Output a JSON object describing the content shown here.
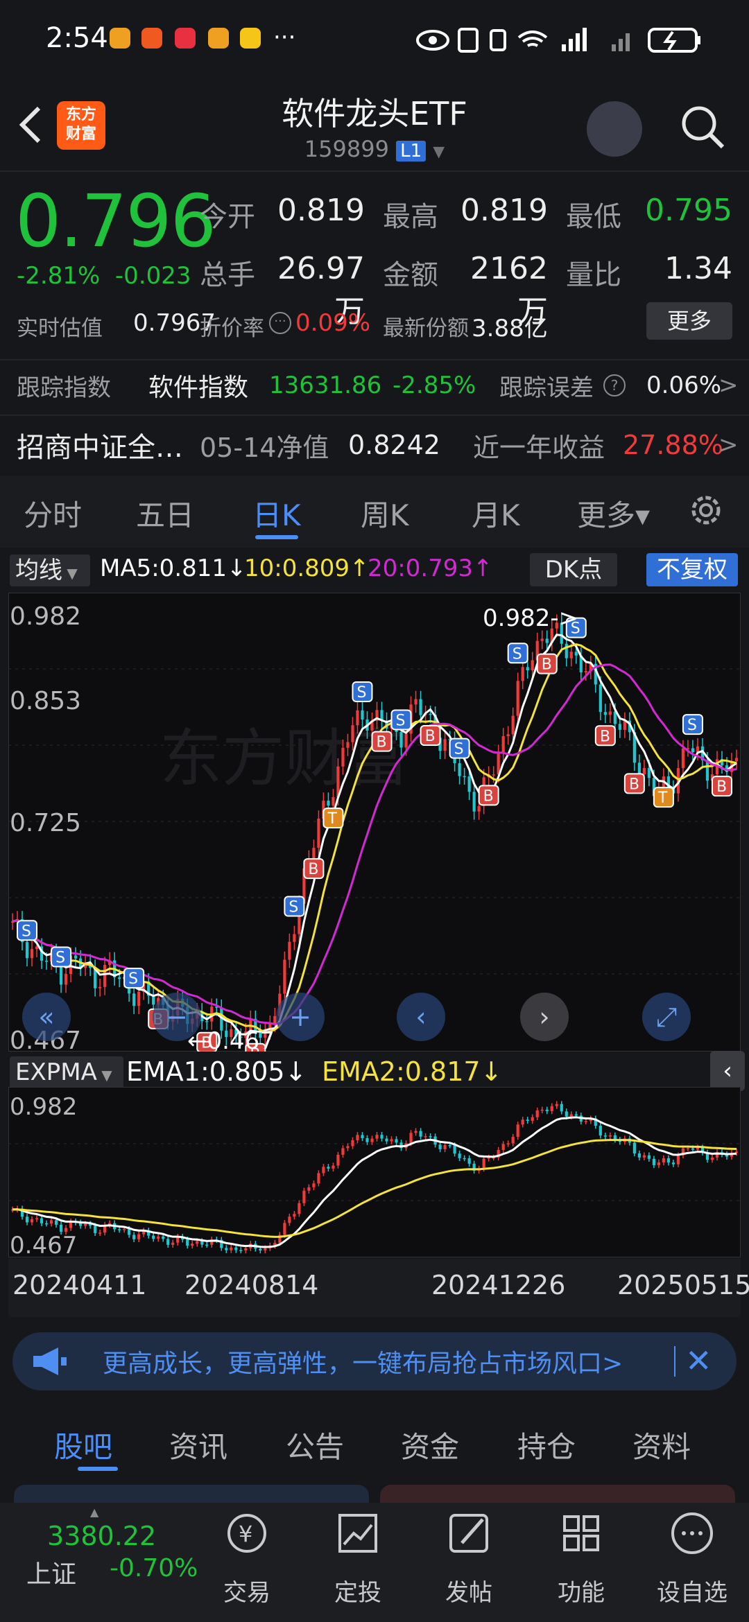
{
  "status": {
    "time": "2:54",
    "more": "···"
  },
  "header": {
    "title": "软件龙头ETF",
    "code": "159899",
    "level": "L1",
    "logo_text": "东方\n财富"
  },
  "quote": {
    "price": "0.796",
    "change_pct": "-2.81%",
    "change": "-0.023",
    "open_label": "今开",
    "open": "0.819",
    "high_label": "最高",
    "high": "0.819",
    "low_label": "最低",
    "low": "0.795",
    "vol_label": "总手",
    "vol": "26.97万",
    "amt_label": "金额",
    "amt": "2162万",
    "ratio_label": "量比",
    "ratio": "1.34",
    "iopv_label": "实时估值",
    "iopv": "0.7967",
    "discount_label": "折价率",
    "discount": "0.09%",
    "shares_label": "最新份额",
    "shares": "3.88亿",
    "more": "更多"
  },
  "tracking": {
    "label": "跟踪指数",
    "index": "软件指数",
    "index_val": "13631.86",
    "index_chg": "-2.85%",
    "err_label": "跟踪误差",
    "err_val": "0.06%"
  },
  "fund": {
    "name": "招商中证全…",
    "nav_label": "05-14净值",
    "nav": "0.8242",
    "yr_label": "近一年收益",
    "yr": "27.88%"
  },
  "tabs": [
    "分时",
    "五日",
    "日K",
    "周K",
    "月K",
    "更多▾"
  ],
  "ma": {
    "btn": "均线",
    "ma5": "MA5:0.811↓",
    "ma10": "10:0.809↑",
    "ma20": "20:0.793↑",
    "dk": "DK点",
    "fq": "不复权"
  },
  "kchart": {
    "ymax": "0.982",
    "y2": "0.853",
    "y3": "0.725",
    "ymin": "0.467",
    "max_note": "0.982->",
    "min_note": "←0.467",
    "watermark": "东方财富"
  },
  "expma": {
    "btn": "EXPMA",
    "ema1": "EMA1:0.805↓",
    "ema2": "EMA2:0.817↓",
    "ymax": "0.982",
    "ymin": "0.467"
  },
  "dates": [
    "20240411",
    "20240814",
    "20241226",
    "20250515"
  ],
  "banner": {
    "text": "更高成长，更高弹性，一键布局抢占市场风口>"
  },
  "bottom_tabs": [
    "股吧",
    "资讯",
    "公告",
    "资金",
    "持仓",
    "资料"
  ],
  "nav": {
    "index_val": "3380.22",
    "index_name": "上证",
    "index_chg": "-0.70%",
    "items": [
      "交易",
      "定投",
      "发帖",
      "功能",
      "设自选"
    ]
  },
  "colors": {
    "up": "#f23a3a",
    "down": "#1fc23a",
    "accent": "#4c8ef7",
    "ma5": "#ffffff",
    "ma10": "#f5e33b",
    "ma20": "#d12ad1"
  },
  "chart_data": {
    "type": "candlestick",
    "title": "",
    "x_labels": [
      "20240411",
      "20240814",
      "20241226",
      "20250515"
    ],
    "ylim": [
      0.467,
      0.982
    ],
    "y_ticks": [
      0.982,
      0.853,
      0.725,
      0.467
    ],
    "max_point": 0.982,
    "min_point": 0.467,
    "close_trend": [
      0.6,
      0.58,
      0.56,
      0.55,
      0.56,
      0.54,
      0.55,
      0.53,
      0.52,
      0.51,
      0.5,
      0.49,
      0.5,
      0.48,
      0.47,
      0.47,
      0.48,
      0.55,
      0.66,
      0.72,
      0.78,
      0.84,
      0.86,
      0.85,
      0.83,
      0.87,
      0.85,
      0.82,
      0.78,
      0.75,
      0.8,
      0.86,
      0.92,
      0.96,
      0.95,
      0.93,
      0.9,
      0.86,
      0.84,
      0.8,
      0.76,
      0.78,
      0.82,
      0.8,
      0.79,
      0.8
    ],
    "ema1_last": 0.805,
    "ema2_last": 0.817
  }
}
